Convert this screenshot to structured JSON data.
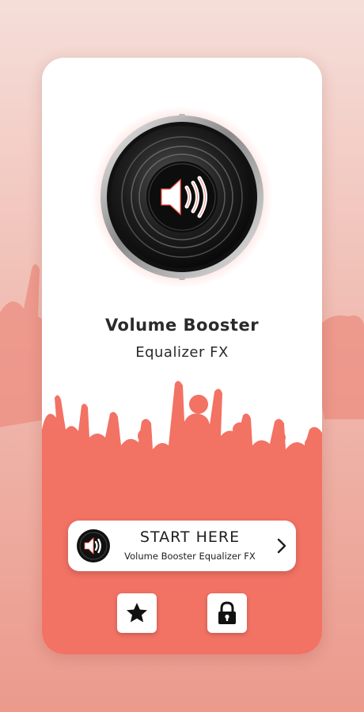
{
  "app": {
    "title": "Volume Booster",
    "subtitle": "Equalizer FX"
  },
  "start_button": {
    "label": "START HERE",
    "sublabel": "Volume Booster Equalizer FX"
  },
  "actions": {
    "rate_icon": "star-icon",
    "lock_icon": "lock-icon"
  },
  "colors": {
    "accent": "#f27264",
    "background_top": "#f5ded9",
    "background_bottom": "#eb9a8c",
    "text": "#2a2a2a"
  }
}
